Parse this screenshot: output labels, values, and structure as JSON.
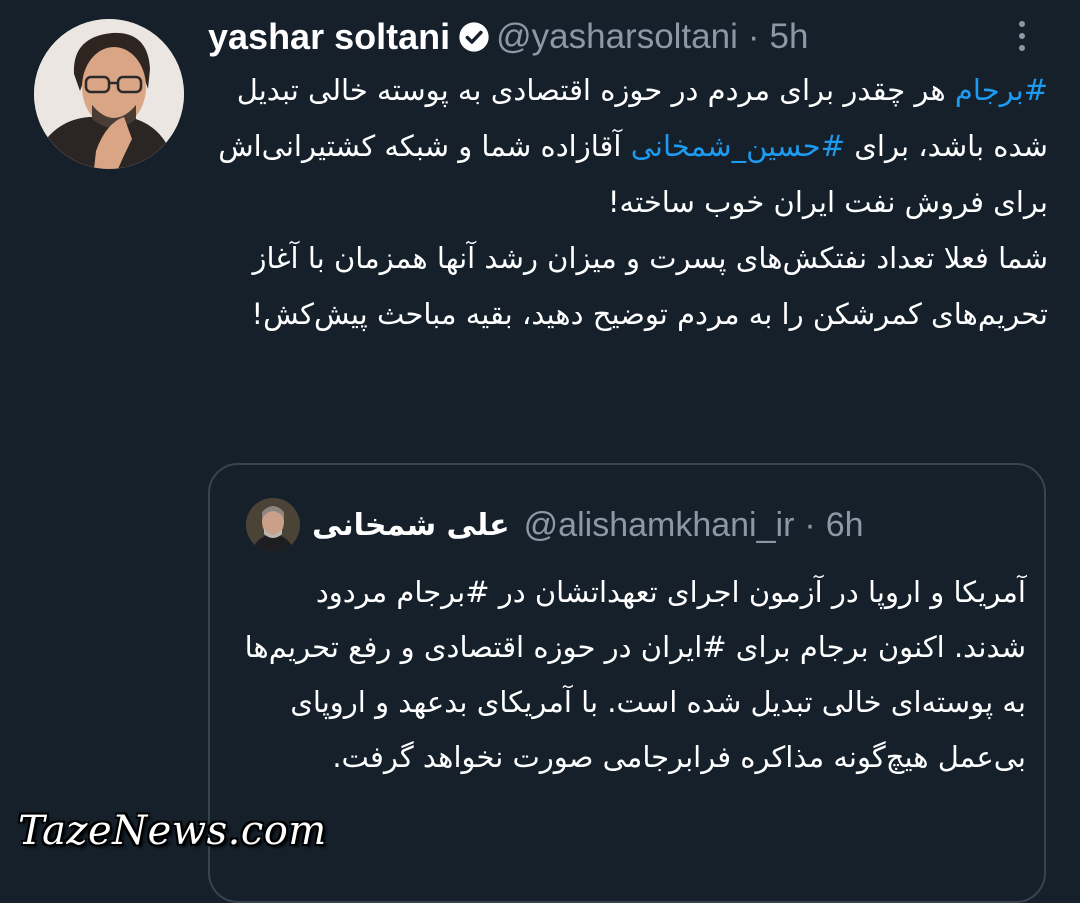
{
  "tweet": {
    "author": {
      "display_name": "yashar soltani",
      "handle": "@yasharsoltani",
      "verified_icon": "verified-badge-icon"
    },
    "separator": "·",
    "time": "5h",
    "more_icon": "more-options-icon",
    "text": [
      {
        "tag": "#برجام"
      },
      {
        "text": " هر چقدر برای مردم در حوزه اقتصادی به پوسته خالی تبدیل شده باشد، برای "
      },
      {
        "tag": "#حسین_شمخانی"
      },
      {
        "text": " آقازاده شما و شبکه کشتیرانی‌اش برای فروش نفت ایران خوب ساخته!"
      },
      {
        "break": true
      },
      {
        "text": "شما فعلا تعداد نفتکش‌های پسرت و میزان رشد آنها همزمان با آغاز تحریم‌های کمرشکن را به مردم توضیح دهید، بقیه مباحث پیش‌کش!"
      }
    ]
  },
  "quoted_tweet": {
    "author": {
      "display_name": "علی شمخانی",
      "handle": "@alishamkhani_ir"
    },
    "separator": "·",
    "time": "6h",
    "text": "آمریکا و اروپا در آزمون اجرای تعهداتشان در #برجام مردود شدند. اکنون برجام برای #ایران در حوزه اقتصادی و رفع تحریم‌ها به پوسته‌ای خالی تبدیل شده است. با آمریکای بدعهد و اروپای بی‌عمل هیچ‌گونه مذاکره فرابرجامی صورت نخواهد گرفت."
  },
  "watermark": "TazeNews.com",
  "colors": {
    "background": "#15202b",
    "text": "#ffffff",
    "muted": "#8b98a5",
    "hashtag": "#1d9bf0",
    "quote_border": "#38444d"
  }
}
